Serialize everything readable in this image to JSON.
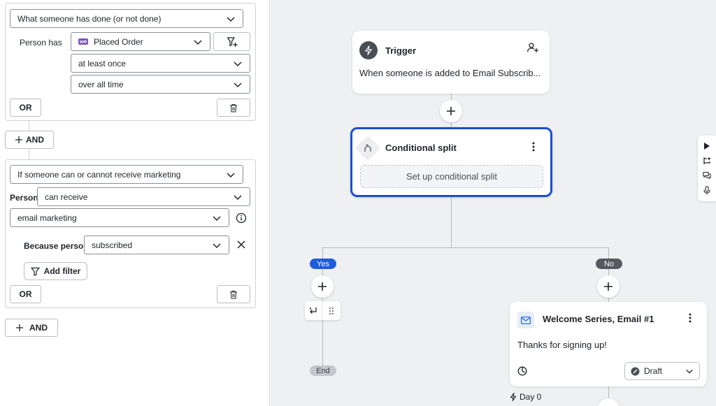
{
  "left_panel": {
    "group1": {
      "condition_type": "What someone has done (or not done)",
      "person_label": "Person has",
      "metric": "Placed Order",
      "frequency": "at least once",
      "timeframe": "over all time",
      "or_label": "OR"
    },
    "and_button_1": "AND",
    "group2": {
      "condition_type": "If someone can or cannot receive marketing",
      "person_label": "Person",
      "can_receive": "can receive",
      "channel": "email marketing",
      "because_label": "Because person",
      "because_value": "subscribed",
      "add_filter_label": "Add filter",
      "or_label": "OR"
    },
    "and_button_2": "AND"
  },
  "canvas": {
    "trigger": {
      "title": "Trigger",
      "description": "When someone is added to Email Subscrib..."
    },
    "conditional_split": {
      "title": "Conditional split",
      "setup_button": "Set up conditional split"
    },
    "yes_label": "Yes",
    "no_label": "No",
    "end_label": "End",
    "email_card": {
      "title": "Welcome Series, Email #1",
      "body": "Thanks for signing up!",
      "status": "Draft"
    },
    "delay_label": "Day 0"
  },
  "colors": {
    "accent_blue": "#1b4fd1",
    "yes_pill": "#1d5ddb",
    "no_pill": "#555a60",
    "end_pill": "#c4c7cb",
    "canvas_bg": "#eef0f2"
  }
}
